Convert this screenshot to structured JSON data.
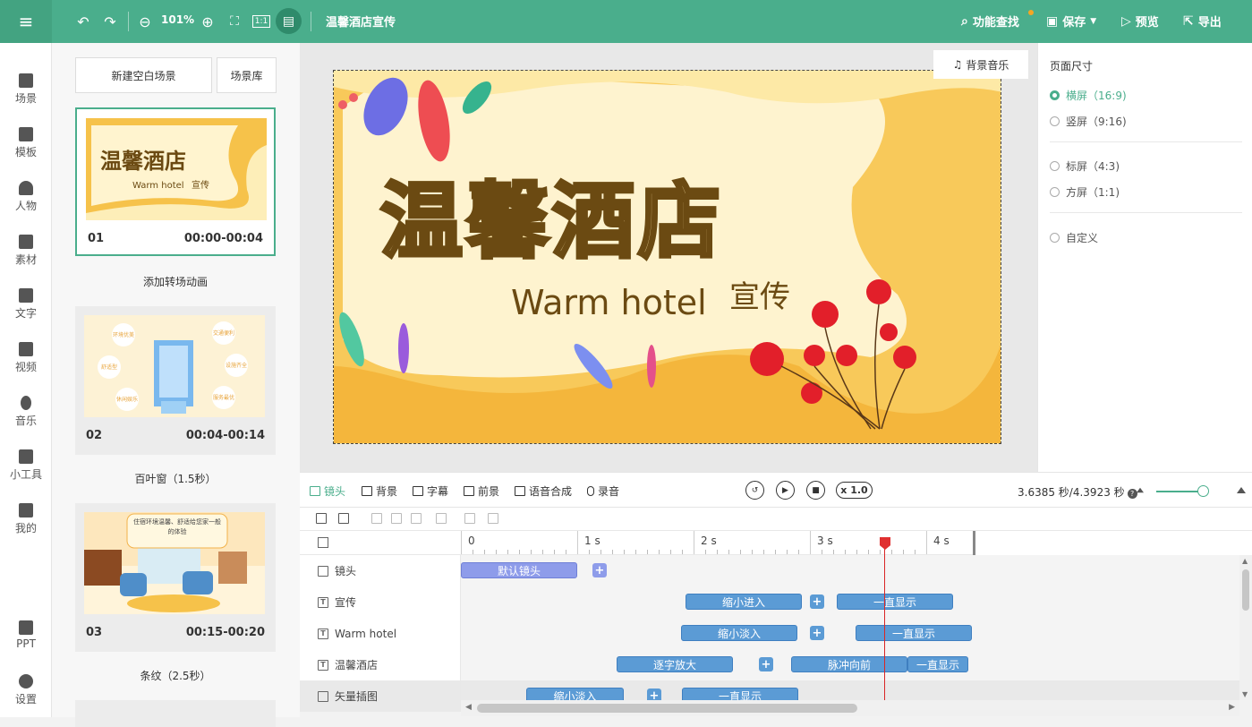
{
  "topbar": {
    "zoom": "101%",
    "title": "温馨酒店宣传",
    "find_label": "功能查找",
    "save_label": "保存",
    "preview_label": "预览",
    "export_label": "导出"
  },
  "leftbar": {
    "items": [
      {
        "label": "场景"
      },
      {
        "label": "模板"
      },
      {
        "label": "人物"
      },
      {
        "label": "素材"
      },
      {
        "label": "文字"
      },
      {
        "label": "视频"
      },
      {
        "label": "音乐"
      },
      {
        "label": "小工具"
      },
      {
        "label": "我的"
      },
      {
        "label": "PPT"
      },
      {
        "label": "设置"
      }
    ]
  },
  "scenes": {
    "new_blank": "新建空白场景",
    "library": "场景库",
    "list": [
      {
        "num": "01",
        "time": "00:00-00:04",
        "transition": "添加转场动画",
        "thumb_title": "温馨酒店",
        "thumb_sub": "Warm hotel",
        "thumb_sub2": "宣传"
      },
      {
        "num": "02",
        "time": "00:04-00:14",
        "transition": "百叶窗（1.5秒）",
        "bubbles": [
          "环境优美",
          "交通便利",
          "舒适型",
          "设施齐全",
          "休闲娱乐",
          "服务最优"
        ]
      },
      {
        "num": "03",
        "time": "00:15-00:20",
        "transition": "条纹（2.5秒）",
        "caption": "住宿环境温馨、舒适给您家一般的体验"
      }
    ]
  },
  "canvas": {
    "title": "温馨酒店",
    "subtitle_en": "Warm hotel",
    "subtitle_cn": "宣传",
    "bgm_label": "背景音乐"
  },
  "rightpanel": {
    "title": "页面尺寸",
    "options": [
      {
        "label": "横屏（16:9)",
        "selected": true
      },
      {
        "label": "竖屏（9:16)",
        "selected": false
      },
      {
        "label": "标屏（4:3)",
        "selected": false
      },
      {
        "label": "方屏（1:1)",
        "selected": false
      },
      {
        "label": "自定义",
        "selected": false
      }
    ]
  },
  "timeline": {
    "tabs": [
      "镜头",
      "背景",
      "字幕",
      "前景",
      "语音合成",
      "录音"
    ],
    "speed": "x 1.0",
    "time": "3.6385 秒/4.3923 秒",
    "ruler": [
      "0",
      "1 s",
      "2 s",
      "3 s",
      "4 s"
    ],
    "playhead_seconds": 3.6385,
    "tracks": [
      {
        "name": "镜头",
        "clips": [
          {
            "label": "默认镜头",
            "start": 0,
            "end": 1.0,
            "kind": "cam"
          }
        ],
        "plus": [
          1.13
        ]
      },
      {
        "name": "宣传",
        "clips": [
          {
            "label": "缩小进入",
            "start": 1.93,
            "end": 2.93
          },
          {
            "label": "一直显示",
            "start": 3.23,
            "end": 4.23
          }
        ],
        "plus": [
          3.0
        ]
      },
      {
        "name": "Warm hotel",
        "clips": [
          {
            "label": "缩小淡入",
            "start": 1.89,
            "end": 2.89
          },
          {
            "label": "一直显示",
            "start": 3.39,
            "end": 4.39
          }
        ],
        "plus": [
          3.0
        ]
      },
      {
        "name": "温馨酒店",
        "clips": [
          {
            "label": "逐字放大",
            "start": 1.34,
            "end": 2.34
          },
          {
            "label": "脉冲向前",
            "start": 2.84,
            "end": 3.84
          },
          {
            "label": "一直显示",
            "start": 3.84,
            "end": 4.36
          }
        ],
        "plus": [
          2.56
        ]
      },
      {
        "name": "矢量插图",
        "clips": [
          {
            "label": "缩小淡入",
            "start": 0.56,
            "end": 1.4
          },
          {
            "label": "一直显示",
            "start": 1.9,
            "end": 2.9
          }
        ],
        "plus": [
          1.6
        ]
      }
    ]
  },
  "colors": {
    "accent": "#4aae8c",
    "clip": "#5b9bd5",
    "camera_clip": "#8e9cea",
    "playhead": "#d92525",
    "title_brown": "#6b4a12"
  }
}
